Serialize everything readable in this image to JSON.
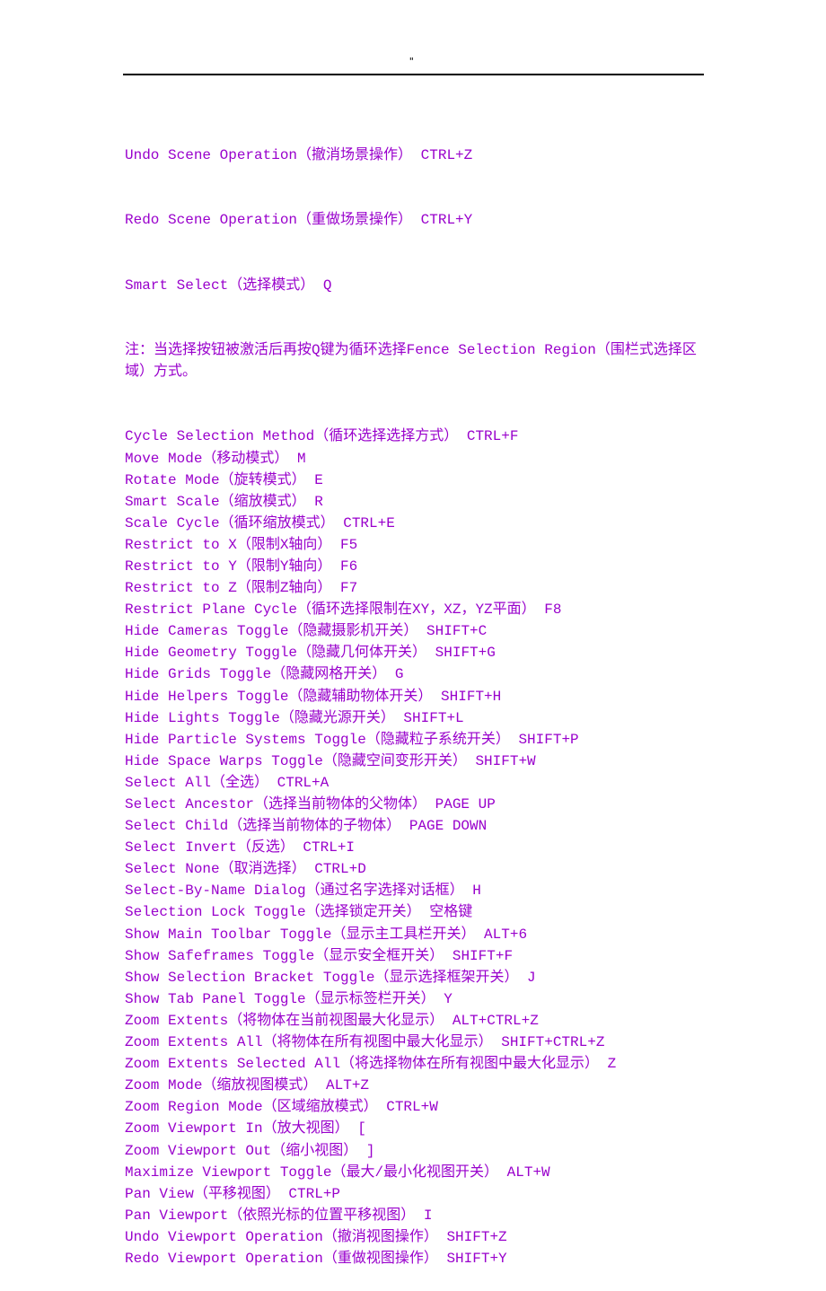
{
  "header": {
    "mark": "\""
  },
  "colors": {
    "text": "#9900cc"
  },
  "lines": [
    "Undo Scene Operation（撤消场景操作） CTRL+Z",
    "Redo Scene Operation（重做场景操作） CTRL+Y",
    "Smart Select（选择模式） Q"
  ],
  "note": "注：当选择按钮被激活后再按Q键为循环选择Fence Selection Region（围栏式选择区域）方式。",
  "lines2": [
    "Cycle Selection Method（循环选择选择方式） CTRL+F",
    "Move Mode（移动模式） M",
    "Rotate Mode（旋转模式） E",
    "Smart Scale（缩放模式） R",
    "Scale Cycle（循环缩放模式） CTRL+E",
    "Restrict to X（限制X轴向） F5",
    "Restrict to Y（限制Y轴向） F6",
    "Restrict to Z（限制Z轴向） F7",
    "Restrict Plane Cycle（循环选择限制在XY，XZ，YZ平面） F8",
    "Hide Cameras Toggle（隐藏摄影机开关） SHIFT+C",
    "Hide Geometry Toggle（隐藏几何体开关） SHIFT+G",
    "Hide Grids Toggle（隐藏网格开关） G",
    "Hide Helpers Toggle（隐藏辅助物体开关） SHIFT+H",
    "Hide Lights Toggle（隐藏光源开关） SHIFT+L",
    "Hide Particle Systems Toggle（隐藏粒子系统开关） SHIFT+P",
    "Hide Space Warps Toggle（隐藏空间变形开关） SHIFT+W",
    "Select All（全选） CTRL+A",
    "Select Ancestor（选择当前物体的父物体） PAGE UP",
    "Select Child（选择当前物体的子物体） PAGE DOWN",
    "Select Invert（反选） CTRL+I",
    "Select None（取消选择） CTRL+D",
    "Select-By-Name Dialog（通过名字选择对话框） H",
    "Selection Lock Toggle（选择锁定开关） 空格键",
    "Show Main Toolbar Toggle（显示主工具栏开关） ALT+6",
    "Show Safeframes Toggle（显示安全框开关） SHIFT+F",
    "Show Selection Bracket Toggle（显示选择框架开关） J",
    "Show Tab Panel Toggle（显示标签栏开关） Y",
    "Zoom Extents（将物体在当前视图最大化显示） ALT+CTRL+Z",
    "Zoom Extents All（将物体在所有视图中最大化显示） SHIFT+CTRL+Z",
    "Zoom Extents Selected All（将选择物体在所有视图中最大化显示） Z",
    "Zoom Mode（缩放视图模式） ALT+Z",
    "Zoom Region Mode（区域缩放模式） CTRL+W",
    "Zoom Viewport In（放大视图） [",
    "Zoom Viewport Out（缩小视图） ]",
    "Maximize Viewport Toggle（最大/最小化视图开关） ALT+W",
    "Pan View（平移视图） CTRL+P",
    "Pan Viewport（依照光标的位置平移视图） I",
    "Undo Viewport Operation（撤消视图操作） SHIFT+Z",
    "Redo Viewport Operation（重做视图操作） SHIFT+Y"
  ]
}
